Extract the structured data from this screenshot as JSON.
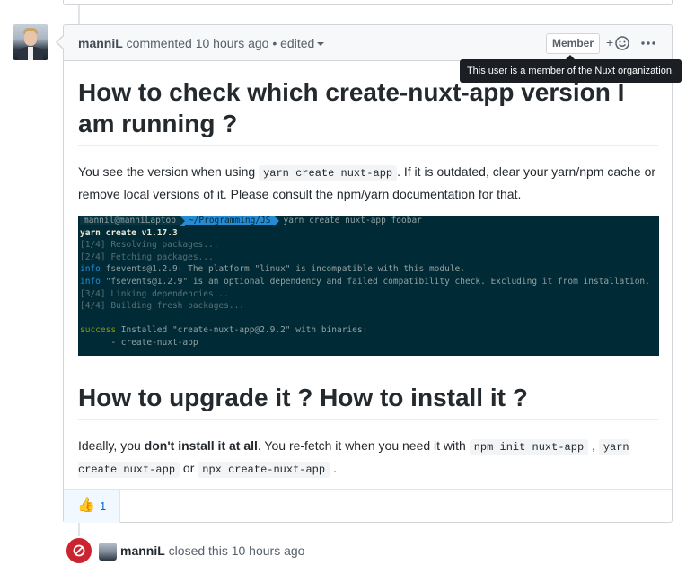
{
  "comment": {
    "author": "manniL",
    "action": "commented",
    "time": "10 hours ago",
    "separator": "•",
    "edited": "edited",
    "badge": "Member",
    "tooltip": "This user is a member of the Nuxt organization.",
    "react_plus": "+",
    "body": {
      "heading1": "How to check which create-nuxt-app version I am running ?",
      "para1": {
        "t1": "You see the version when using ",
        "code1": "yarn create nuxt-app",
        "t2": ". If it is outdated, clear your yarn/npm cache or remove local versions of it. Please consult the npm/yarn documentation for that."
      },
      "terminal": {
        "prompt_user": "mannil@manniLaptop",
        "prompt_path": "~/Programming/JS",
        "command": "yarn create nuxt-app foobar",
        "version_line": "yarn create v1.17.3",
        "step1": "[1/4] Resolving packages...",
        "step2": "[2/4] Fetching packages...",
        "info_label": "info",
        "info1": " fsevents@1.2.9: The platform \"linux\" is incompatible with this module.",
        "info2": " \"fsevents@1.2.9\" is an optional dependency and failed compatibility check. Excluding it from installation.",
        "step3": "[3/4] Linking dependencies...",
        "step4": "[4/4] Building fresh packages...",
        "success_label": "success",
        "success_text": " Installed \"create-nuxt-app@2.9.2\" with binaries:",
        "binary": "      - create-nuxt-app"
      },
      "heading2": "How to upgrade it ? How to install it ?",
      "para2": {
        "t1": "Ideally, you ",
        "bold": "don't install it at all",
        "t2": ". You re-fetch it when you need it with ",
        "code1": "npm init nuxt-app",
        "t3": " , ",
        "code2": "yarn create nuxt-app",
        "t4": " or ",
        "code3": "npx create-nuxt-app",
        "t5": " ."
      }
    },
    "reactions": [
      {
        "icon": "thumbs-up-icon",
        "emoji": "👍",
        "count": "1"
      }
    ]
  },
  "closed_event": {
    "author": "manniL",
    "text": "closed this 10 hours ago",
    "badge_color": "#cb2431"
  }
}
